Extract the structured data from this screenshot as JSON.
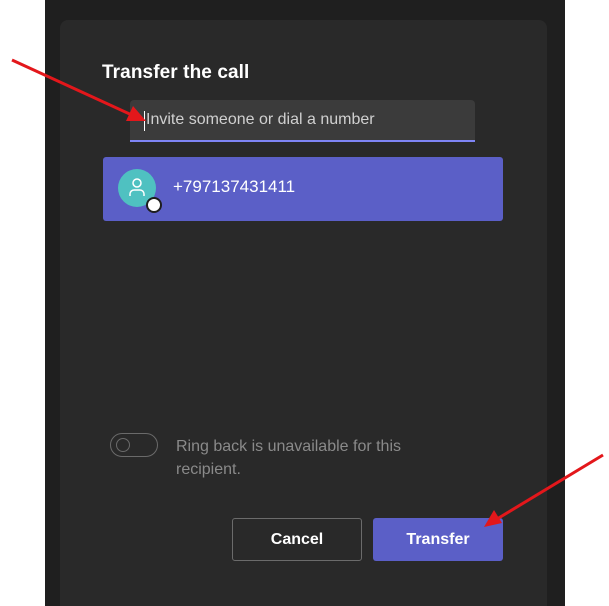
{
  "dialog": {
    "title": "Transfer the call"
  },
  "search": {
    "placeholder": "Invite someone or dial a number",
    "value": ""
  },
  "recipient": {
    "icon": "person-icon",
    "presence": "status-dot",
    "number": "+797137431411"
  },
  "ring_back": {
    "enabled": false,
    "text": "Ring back is unavailable for this recipient."
  },
  "buttons": {
    "cancel_label": "Cancel",
    "transfer_label": "Transfer"
  },
  "colors": {
    "accent": "#5b5fc7",
    "dialog_background": "#292929",
    "avatar": "#4fc1c1",
    "annotation_arrow": "#e3171b"
  }
}
